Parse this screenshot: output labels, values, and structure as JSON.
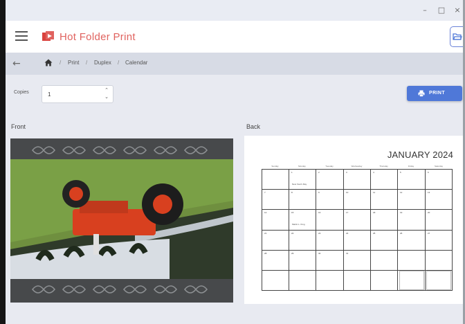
{
  "window": {
    "minimize_glyph": "–",
    "maximize_glyph": "□",
    "close_glyph": "×"
  },
  "header": {
    "title": "Hot Folder Print",
    "menu_icon": "hamburger-icon",
    "logo_icon": "printer-logo-icon",
    "open_folder_icon": "folder-open-icon",
    "brand_color": "#e0625e"
  },
  "breadcrumb": {
    "back_icon": "arrow-left-icon",
    "back_glyph": "←",
    "home_icon": "home-icon",
    "items": [
      "Print",
      "Duplex",
      "Calendar"
    ],
    "separator": "/"
  },
  "copies": {
    "label": "Copies",
    "value": "1",
    "up_glyph": "⌃",
    "down_glyph": "⌄"
  },
  "print_button": {
    "label": "PRINT",
    "icon": "printer-icon",
    "color": "#4f78d8"
  },
  "front": {
    "label": "Front",
    "image": "tractor-photo"
  },
  "back": {
    "label": "Back",
    "calendar": {
      "title": "JANUARY 2024",
      "weekdays": [
        "Sunday",
        "Monday",
        "Tuesday",
        "Wednesday",
        "Thursday",
        "Friday",
        "Saturday"
      ],
      "weeks": [
        [
          "",
          "1",
          "2",
          "3",
          "4",
          "5",
          "6"
        ],
        [
          "7",
          "8",
          "9",
          "10",
          "11",
          "12",
          "13"
        ],
        [
          "14",
          "15",
          "16",
          "17",
          "18",
          "19",
          "20"
        ],
        [
          "21",
          "22",
          "23",
          "24",
          "25",
          "26",
          "27"
        ],
        [
          "28",
          "29",
          "30",
          "31",
          "",
          "",
          ""
        ]
      ],
      "events": [
        "New Year's Day",
        "Martin L. King"
      ]
    }
  }
}
